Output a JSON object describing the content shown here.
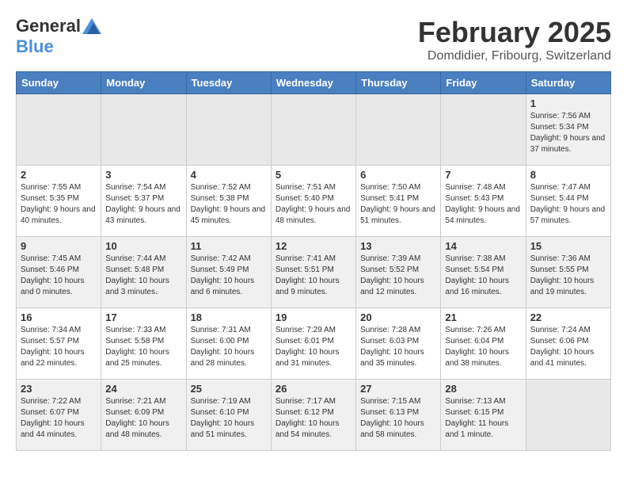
{
  "header": {
    "logo_general": "General",
    "logo_blue": "Blue",
    "month": "February 2025",
    "location": "Domdidier, Fribourg, Switzerland"
  },
  "weekdays": [
    "Sunday",
    "Monday",
    "Tuesday",
    "Wednesday",
    "Thursday",
    "Friday",
    "Saturday"
  ],
  "weeks": [
    [
      {
        "day": "",
        "info": ""
      },
      {
        "day": "",
        "info": ""
      },
      {
        "day": "",
        "info": ""
      },
      {
        "day": "",
        "info": ""
      },
      {
        "day": "",
        "info": ""
      },
      {
        "day": "",
        "info": ""
      },
      {
        "day": "1",
        "info": "Sunrise: 7:56 AM\nSunset: 5:34 PM\nDaylight: 9 hours and 37 minutes."
      }
    ],
    [
      {
        "day": "2",
        "info": "Sunrise: 7:55 AM\nSunset: 5:35 PM\nDaylight: 9 hours and 40 minutes."
      },
      {
        "day": "3",
        "info": "Sunrise: 7:54 AM\nSunset: 5:37 PM\nDaylight: 9 hours and 43 minutes."
      },
      {
        "day": "4",
        "info": "Sunrise: 7:52 AM\nSunset: 5:38 PM\nDaylight: 9 hours and 45 minutes."
      },
      {
        "day": "5",
        "info": "Sunrise: 7:51 AM\nSunset: 5:40 PM\nDaylight: 9 hours and 48 minutes."
      },
      {
        "day": "6",
        "info": "Sunrise: 7:50 AM\nSunset: 5:41 PM\nDaylight: 9 hours and 51 minutes."
      },
      {
        "day": "7",
        "info": "Sunrise: 7:48 AM\nSunset: 5:43 PM\nDaylight: 9 hours and 54 minutes."
      },
      {
        "day": "8",
        "info": "Sunrise: 7:47 AM\nSunset: 5:44 PM\nDaylight: 9 hours and 57 minutes."
      }
    ],
    [
      {
        "day": "9",
        "info": "Sunrise: 7:45 AM\nSunset: 5:46 PM\nDaylight: 10 hours and 0 minutes."
      },
      {
        "day": "10",
        "info": "Sunrise: 7:44 AM\nSunset: 5:48 PM\nDaylight: 10 hours and 3 minutes."
      },
      {
        "day": "11",
        "info": "Sunrise: 7:42 AM\nSunset: 5:49 PM\nDaylight: 10 hours and 6 minutes."
      },
      {
        "day": "12",
        "info": "Sunrise: 7:41 AM\nSunset: 5:51 PM\nDaylight: 10 hours and 9 minutes."
      },
      {
        "day": "13",
        "info": "Sunrise: 7:39 AM\nSunset: 5:52 PM\nDaylight: 10 hours and 12 minutes."
      },
      {
        "day": "14",
        "info": "Sunrise: 7:38 AM\nSunset: 5:54 PM\nDaylight: 10 hours and 16 minutes."
      },
      {
        "day": "15",
        "info": "Sunrise: 7:36 AM\nSunset: 5:55 PM\nDaylight: 10 hours and 19 minutes."
      }
    ],
    [
      {
        "day": "16",
        "info": "Sunrise: 7:34 AM\nSunset: 5:57 PM\nDaylight: 10 hours and 22 minutes."
      },
      {
        "day": "17",
        "info": "Sunrise: 7:33 AM\nSunset: 5:58 PM\nDaylight: 10 hours and 25 minutes."
      },
      {
        "day": "18",
        "info": "Sunrise: 7:31 AM\nSunset: 6:00 PM\nDaylight: 10 hours and 28 minutes."
      },
      {
        "day": "19",
        "info": "Sunrise: 7:29 AM\nSunset: 6:01 PM\nDaylight: 10 hours and 31 minutes."
      },
      {
        "day": "20",
        "info": "Sunrise: 7:28 AM\nSunset: 6:03 PM\nDaylight: 10 hours and 35 minutes."
      },
      {
        "day": "21",
        "info": "Sunrise: 7:26 AM\nSunset: 6:04 PM\nDaylight: 10 hours and 38 minutes."
      },
      {
        "day": "22",
        "info": "Sunrise: 7:24 AM\nSunset: 6:06 PM\nDaylight: 10 hours and 41 minutes."
      }
    ],
    [
      {
        "day": "23",
        "info": "Sunrise: 7:22 AM\nSunset: 6:07 PM\nDaylight: 10 hours and 44 minutes."
      },
      {
        "day": "24",
        "info": "Sunrise: 7:21 AM\nSunset: 6:09 PM\nDaylight: 10 hours and 48 minutes."
      },
      {
        "day": "25",
        "info": "Sunrise: 7:19 AM\nSunset: 6:10 PM\nDaylight: 10 hours and 51 minutes."
      },
      {
        "day": "26",
        "info": "Sunrise: 7:17 AM\nSunset: 6:12 PM\nDaylight: 10 hours and 54 minutes."
      },
      {
        "day": "27",
        "info": "Sunrise: 7:15 AM\nSunset: 6:13 PM\nDaylight: 10 hours and 58 minutes."
      },
      {
        "day": "28",
        "info": "Sunrise: 7:13 AM\nSunset: 6:15 PM\nDaylight: 11 hours and 1 minute."
      },
      {
        "day": "",
        "info": ""
      }
    ]
  ]
}
